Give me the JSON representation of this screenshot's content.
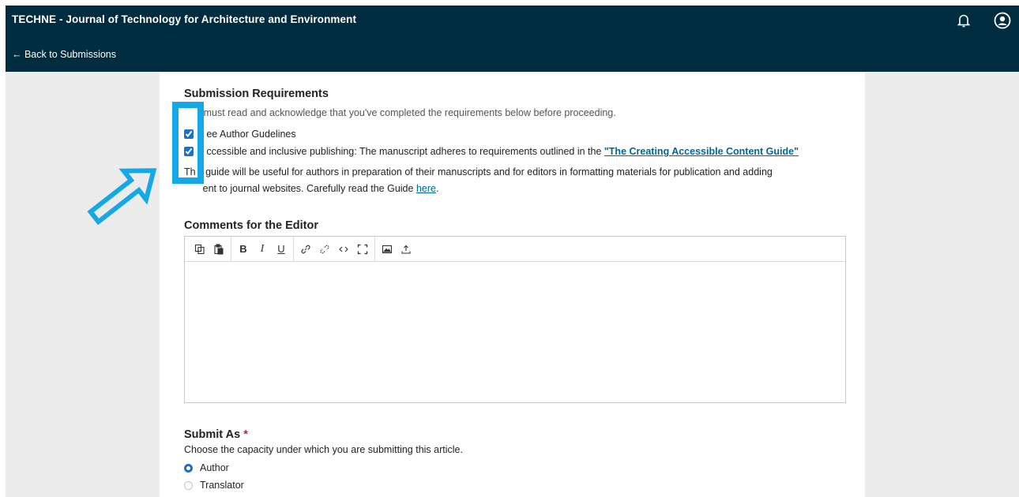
{
  "header": {
    "journal_title": "TECHNE - Journal of Technology for Architecture and Environment",
    "back_link": "← Back to Submissions",
    "notifications_icon": "bell-icon",
    "account_icon": "user-circle-icon",
    "bg_color": "#002c40"
  },
  "requirements": {
    "heading": "Submission Requirements",
    "description_visible": "must read and acknowledge that you've completed the requirements below before proceeding.",
    "items": [
      {
        "label": "ee Author Gudelines",
        "checked": true
      },
      {
        "label_before_link": "ccessible and inclusive publishing: The manuscript adheres to requirements outlined in the ",
        "link": "\"The Creating Accessible Content Guide\"",
        "checked": true
      }
    ],
    "note_line1": "guide will be useful for authors in preparation of their manuscripts and for editors in formatting materials for publication and adding",
    "note_line2_prefix": "ent to journal websites. Carefully read the Guide ",
    "note_line2_link": "here",
    "note_line2_suffix": ".",
    "note_line1_fragment": "Th"
  },
  "comments": {
    "heading": "Comments for the Editor",
    "toolbar_icons": [
      "copy-icon",
      "paste-icon",
      "bold-icon",
      "italic-icon",
      "underline-icon",
      "link-icon",
      "unlink-icon",
      "code-icon",
      "fullscreen-icon",
      "image-icon",
      "upload-icon"
    ]
  },
  "submit_as": {
    "heading": "Submit As",
    "required_mark": "*",
    "description": "Choose the capacity under which you are submitting this article.",
    "options": [
      {
        "label": "Author",
        "selected": true
      },
      {
        "label": "Translator",
        "selected": false
      }
    ]
  },
  "annotation": {
    "color": "#14a8e6"
  }
}
